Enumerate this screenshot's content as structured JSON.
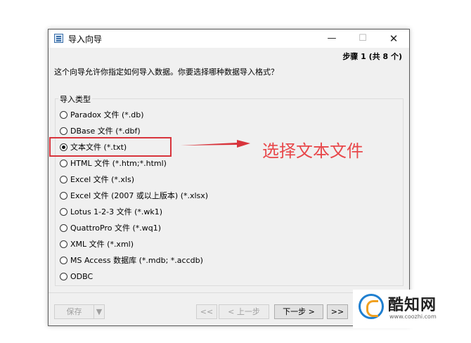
{
  "window": {
    "title": "导入向导",
    "minimize_glyph": "—",
    "maximize_glyph": "☐",
    "close_glyph": "✕"
  },
  "step_text": "步骤 1 (共 8 个)",
  "question": "这个向导允许你指定如何导入数据。你要选择哪种数据导入格式？",
  "group_label": "导入类型",
  "options": [
    {
      "label": "Paradox 文件 (*.db)",
      "selected": false
    },
    {
      "label": "DBase 文件 (*.dbf)",
      "selected": false
    },
    {
      "label": "文本文件 (*.txt)",
      "selected": true
    },
    {
      "label": "HTML 文件 (*.htm;*.html)",
      "selected": false
    },
    {
      "label": "Excel 文件 (*.xls)",
      "selected": false
    },
    {
      "label": "Excel 文件 (2007 或以上版本) (*.xlsx)",
      "selected": false
    },
    {
      "label": "Lotus 1-2-3 文件 (*.wk1)",
      "selected": false
    },
    {
      "label": "QuattroPro 文件 (*.wq1)",
      "selected": false
    },
    {
      "label": "XML 文件 (*.xml)",
      "selected": false
    },
    {
      "label": "MS Access 数据库 (*.mdb; *.accdb)",
      "selected": false
    },
    {
      "label": "ODBC",
      "selected": false
    }
  ],
  "annotation": {
    "text": "选择文本文件",
    "color": "#e8474a"
  },
  "buttons": {
    "save": "保存",
    "save_dropdown": "▼",
    "first": "<<",
    "prev": "< 上一步",
    "next": "下一步 >",
    "last": ">>"
  },
  "watermark": {
    "name": "酷知网",
    "url": "www.coozhi.com"
  }
}
